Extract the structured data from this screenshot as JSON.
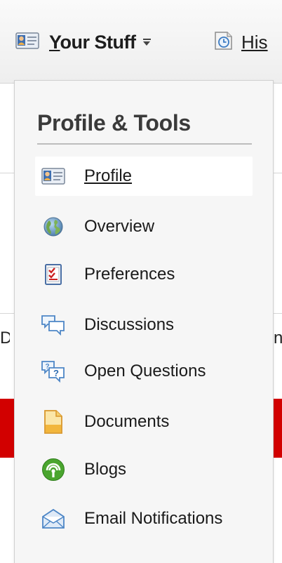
{
  "nav": {
    "your_stuff": {
      "label_first": "Y",
      "label_rest": "our Stuff",
      "icon": "profile-card-icon"
    },
    "history": {
      "label": "His",
      "icon": "history-icon"
    }
  },
  "background": {
    "left_fragment": "D",
    "right_fragment": "n",
    "accent_color": "#d20000"
  },
  "dropdown": {
    "title": "Profile & Tools",
    "items": [
      {
        "label": "Profile",
        "icon": "profile-card-icon",
        "active": true
      },
      {
        "label": "Overview",
        "icon": "globe-icon",
        "active": false
      },
      {
        "label": "Preferences",
        "icon": "checklist-icon",
        "active": false
      },
      {
        "label": "Discussions",
        "icon": "speech-bubbles-icon",
        "active": false
      },
      {
        "label": "Open Questions",
        "icon": "question-bubbles-icon",
        "active": false
      },
      {
        "label": "Documents",
        "icon": "document-icon",
        "active": false
      },
      {
        "label": "Blogs",
        "icon": "rss-icon",
        "active": false
      },
      {
        "label": "Email Notifications",
        "icon": "envelope-icon",
        "active": false
      }
    ]
  }
}
